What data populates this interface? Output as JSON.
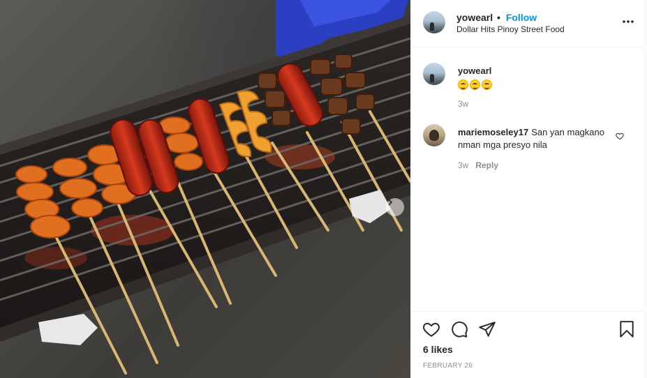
{
  "post": {
    "username": "yowearl",
    "dot": "•",
    "follow_label": "Follow",
    "location": "Dollar Hits Pinoy Street Food"
  },
  "comments": [
    {
      "username": "yowearl",
      "text": "",
      "emoji": [
        "grinning-face",
        "grinning-face",
        "grinning-face"
      ],
      "age": "3w"
    },
    {
      "username": "mariemoseley17",
      "text": "San yan magkano nman mga presyo nila",
      "age": "3w",
      "reply_label": "Reply"
    }
  ],
  "likes_text": "6 likes",
  "date_text": "FEBRUARY 26",
  "icons": {
    "more": "more-horizontal-icon",
    "heart": "heart-outline-icon",
    "comment": "speech-bubble-icon",
    "share": "paper-plane-icon",
    "save": "bookmark-icon",
    "next": "chevron-right-icon"
  },
  "colors": {
    "follow": "#0095f6",
    "meta": "#8e8e8e",
    "text": "#262626"
  }
}
